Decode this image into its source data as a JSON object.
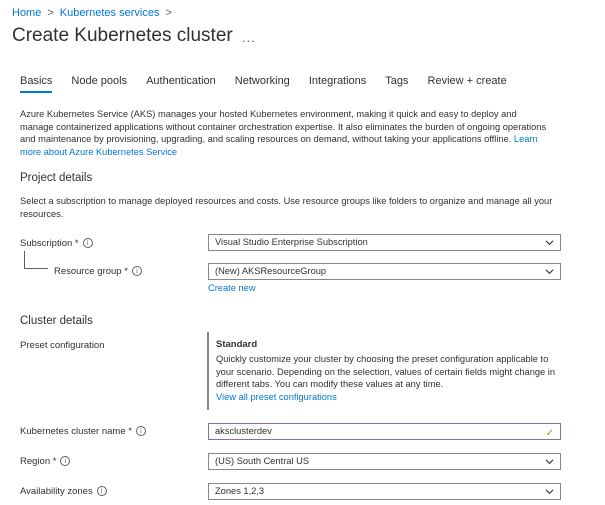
{
  "breadcrumb": {
    "home": "Home",
    "services": "Kubernetes services"
  },
  "page_title": "Create Kubernetes cluster",
  "more_menu": "...",
  "tabs": [
    "Basics",
    "Node pools",
    "Authentication",
    "Networking",
    "Integrations",
    "Tags",
    "Review + create"
  ],
  "intro": {
    "text": "Azure Kubernetes Service (AKS) manages your hosted Kubernetes environment, making it quick and easy to deploy and manage containerized applications without container orchestration expertise. It also eliminates the burden of ongoing operations and maintenance by provisioning, upgrading, and scaling resources on demand, without taking your applications offline.",
    "link": "Learn more about Azure Kubernetes Service"
  },
  "project": {
    "heading": "Project details",
    "description": "Select a subscription to manage deployed resources and costs. Use resource groups like folders to organize and manage all your resources.",
    "subscription_label": "Subscription *",
    "subscription_value": "Visual Studio Enterprise Subscription",
    "resource_group_label": "Resource group *",
    "resource_group_value": "(New) AKSResourceGroup",
    "create_new": "Create new"
  },
  "cluster": {
    "heading": "Cluster details",
    "preset_label": "Preset configuration",
    "preset_title": "Standard",
    "preset_text": "Quickly customize your cluster by choosing the preset configuration applicable to your scenario. Depending on the selection, values of certain fields might change in different tabs. You can modify these values at any time.",
    "preset_link": "View all preset configurations",
    "name_label": "Kubernetes cluster name *",
    "name_value": "aksclusterdev",
    "region_label": "Region *",
    "region_value": "(US) South Central US",
    "zones_label": "Availability zones",
    "zones_value": "Zones 1,2,3"
  },
  "colors": {
    "accent": "#0078d4",
    "valid": "#6bb700"
  },
  "icons": {
    "info": "info-icon",
    "chevron": "chevron-down-icon",
    "check": "checkmark-icon"
  }
}
